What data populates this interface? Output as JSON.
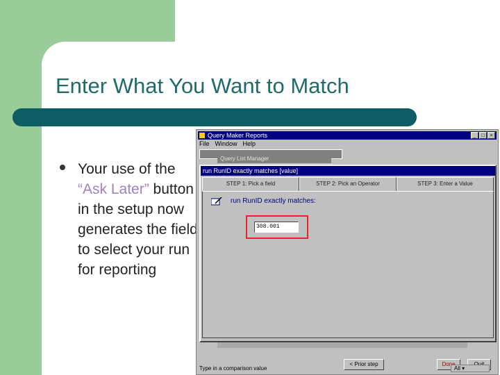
{
  "slide": {
    "title": "Enter What You Want to Match",
    "bullet_before": "Your use of the ",
    "bullet_highlight": "“Ask Later”",
    "bullet_after": " button in the setup now generates the field to select your run for reporting"
  },
  "app": {
    "window_title": "Query Maker Reports",
    "menu": [
      "File",
      "Window",
      "Help"
    ],
    "query_list_manager_title": "Query List Manager",
    "inner_title": "run RunID exactly matches [value]",
    "tabs": [
      "STEP 1: Pick a field",
      "STEP 2: Pick an Operator",
      "STEP 3: Enter a Value"
    ],
    "step_label": "run RunID exactly matches:",
    "value": "308.001",
    "prior_step_label": "< Prior step",
    "done_label": "Done",
    "quit_label": "Quit",
    "status_text": "Type in a comparison value",
    "status_right": "All"
  },
  "colors": {
    "green": "#99cc99",
    "title_teal": "#1f6b6b",
    "bar_teal": "#0e5c64",
    "highlight": "#a080c0",
    "titlebar_blue": "#000080",
    "red_outline": "#ee2222"
  }
}
